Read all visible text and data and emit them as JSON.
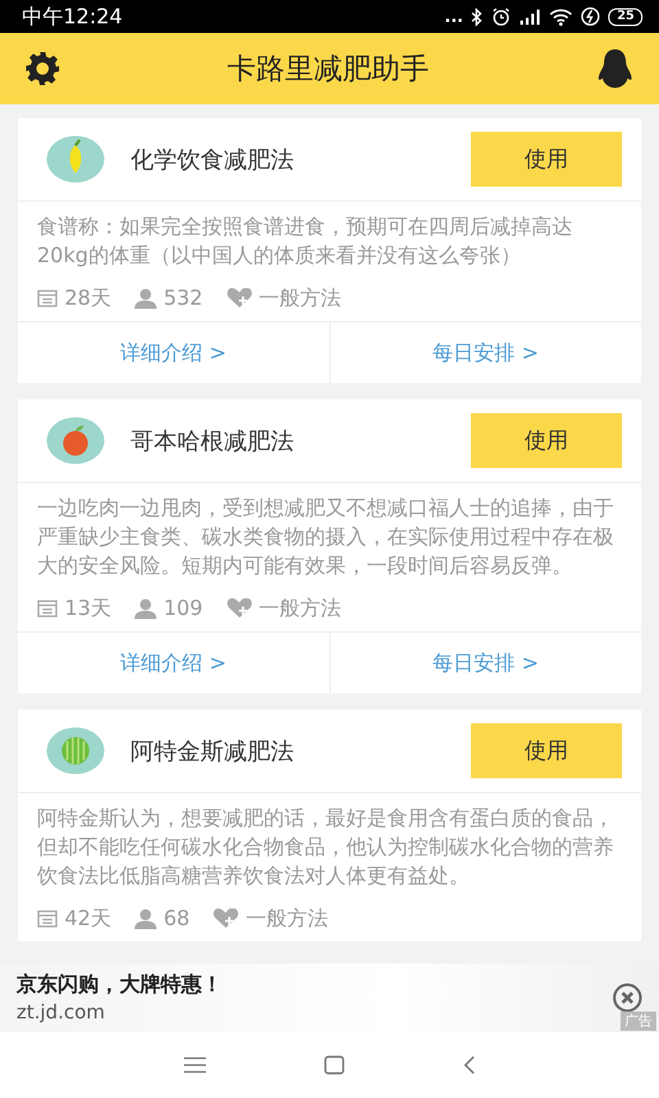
{
  "status_bar": {
    "time": "中午12:24",
    "dots": "...",
    "battery": "25"
  },
  "header": {
    "title": "卡路里减肥助手"
  },
  "plans": [
    {
      "kind": "lemon",
      "name": "化学饮食减肥法",
      "action": "使用",
      "description": "食谱称：如果完全按照食谱进食，预期可在四周后减掉高达20kg的体重（以中国人的体质来看并没有这么夸张）",
      "days": "28天",
      "users": "532",
      "difficulty": "一般方法",
      "links": [
        "详细介绍 >",
        "每日安排 >"
      ]
    },
    {
      "kind": "apple",
      "name": "哥本哈根减肥法",
      "action": "使用",
      "description": "一边吃肉一边甩肉，受到想减肥又不想减口福人士的追捧，由于严重缺少主食类、碳水类食物的摄入，在实际使用过程中存在极大的安全风险。短期内可能有效果，一段时间后容易反弹。",
      "days": "13天",
      "users": "109",
      "difficulty": "一般方法",
      "links": [
        "详细介绍 >",
        "每日安排 >"
      ]
    },
    {
      "kind": "watermelon",
      "name": "阿特金斯减肥法",
      "action": "使用",
      "description": "阿特金斯认为，想要减肥的话，最好是食用含有蛋白质的食品，但却不能吃任何碳水化合物食品，他认为控制碳水化合物的营养饮食法比低脂高糖营养饮食法对人体更有益处。",
      "days": "42天",
      "users": "68",
      "difficulty": "一般方法"
    }
  ],
  "ad": {
    "title": "京东闪购，大牌特惠！",
    "url": "zt.jd.com",
    "tag": "广告"
  }
}
